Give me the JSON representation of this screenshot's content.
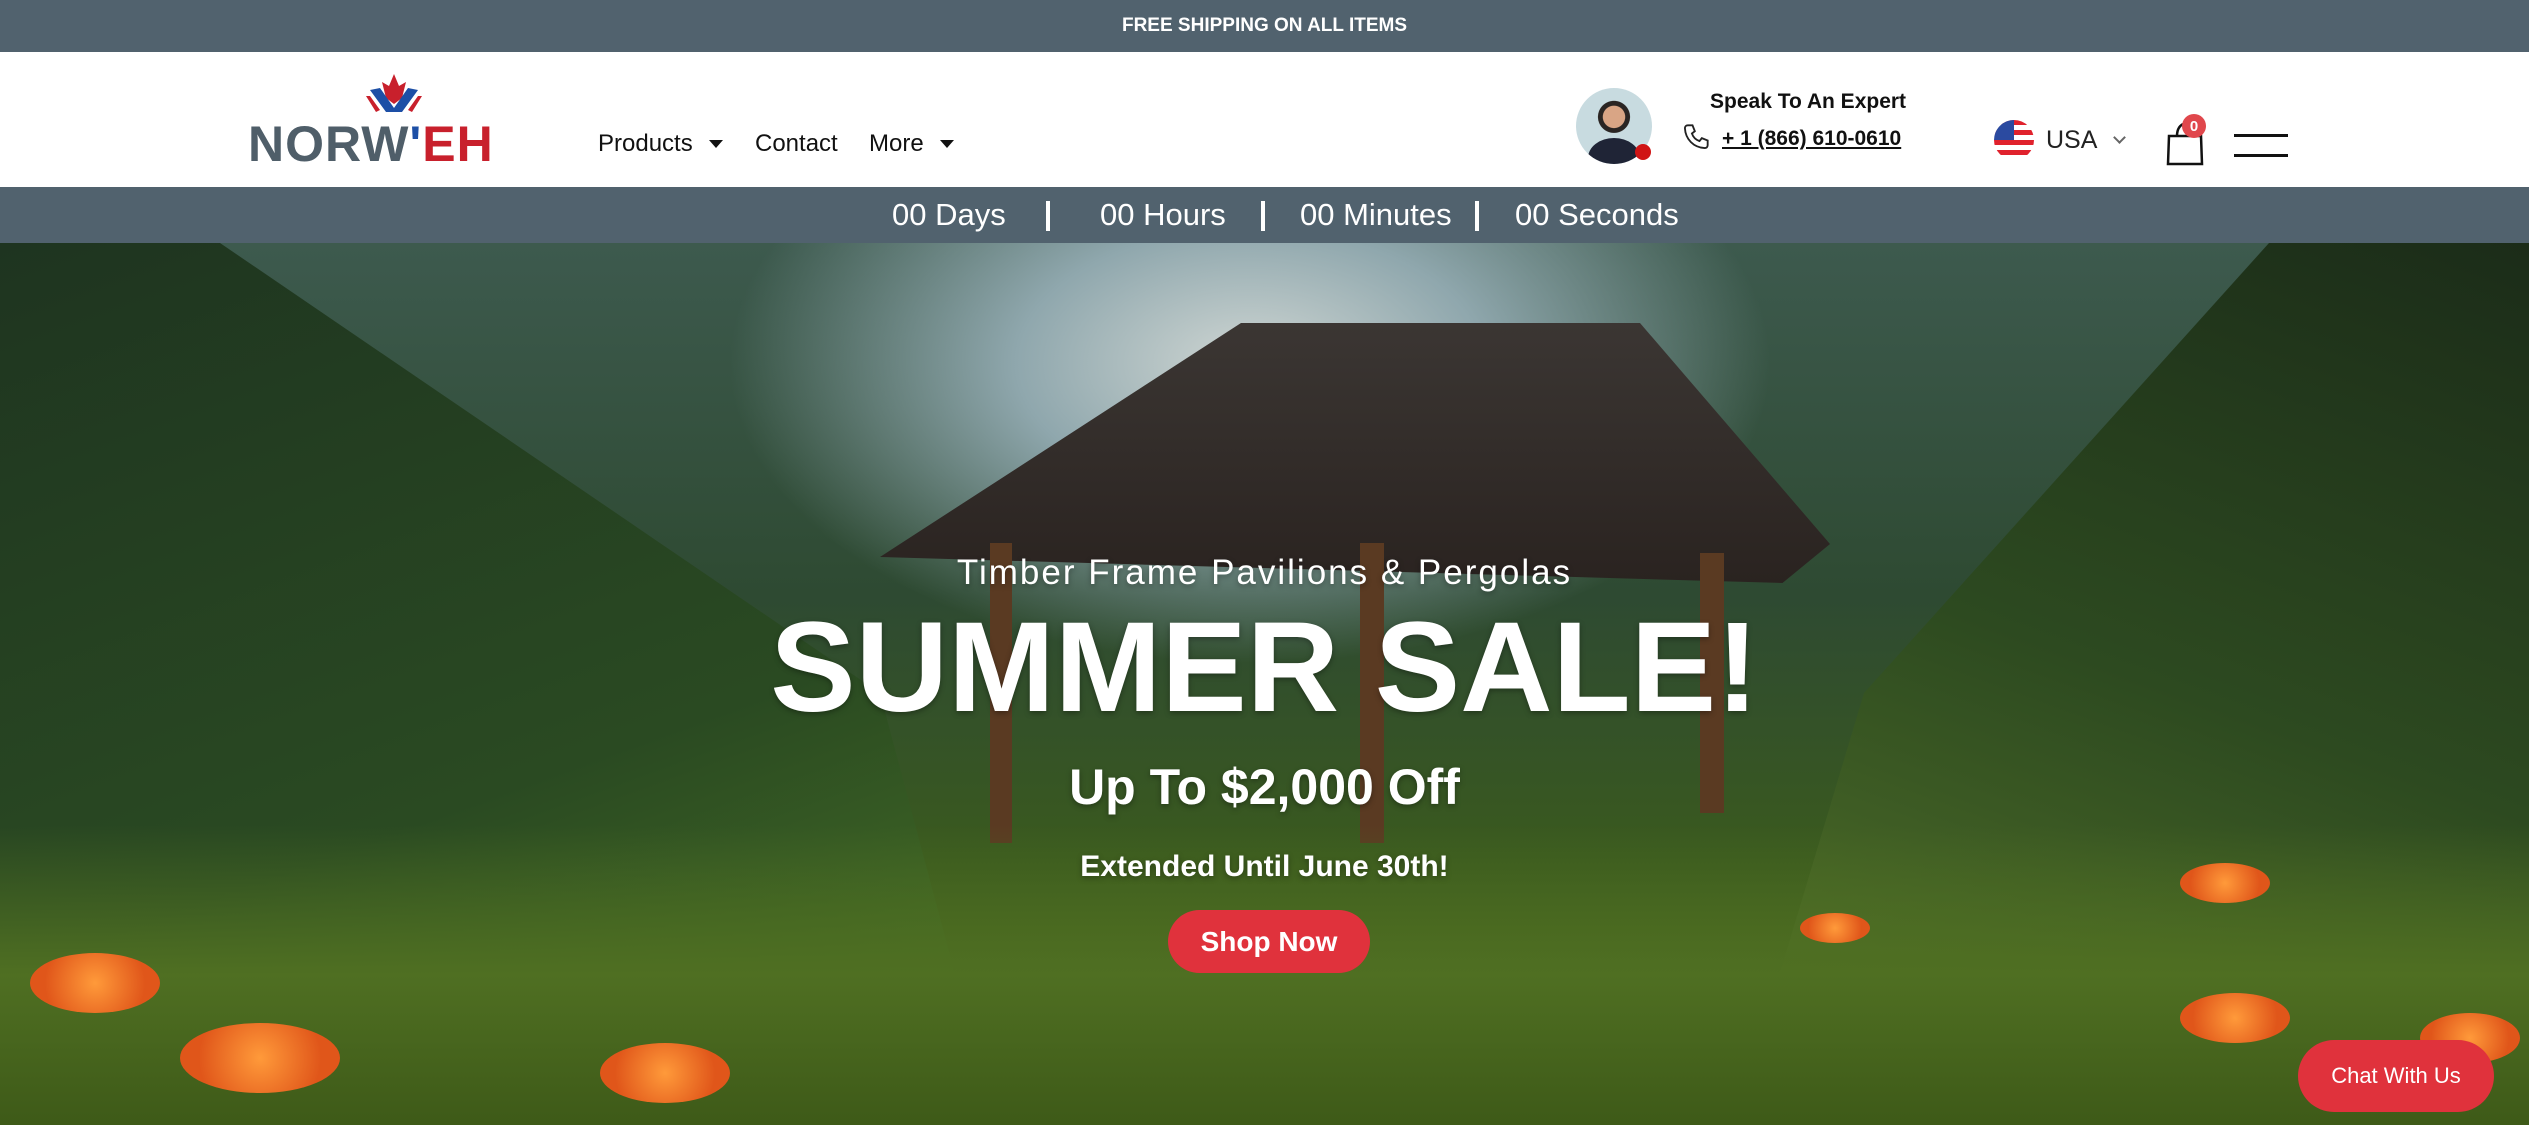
{
  "topbar": {
    "text": "FREE SHIPPING ON ALL ITEMS"
  },
  "header": {
    "logo": {
      "text_left": "NORW",
      "text_right": "EH",
      "apostrophe": "'",
      "colors": {
        "grey": "#4f5e69",
        "red": "#c8202c",
        "blue": "#1d4fa6"
      }
    },
    "nav": [
      {
        "label": "Products",
        "dropdown": true
      },
      {
        "label": "Contact",
        "dropdown": false
      },
      {
        "label": "More",
        "dropdown": true
      }
    ],
    "expert": {
      "title": "Speak To An Expert",
      "phone": "+ 1 (866) 610-0610"
    },
    "region": {
      "label": "USA",
      "icon": "us-flag-icon"
    },
    "cart": {
      "count": "0",
      "icon": "shopping-bag-icon"
    },
    "menu_icon": "hamburger-icon"
  },
  "countdown": {
    "days": "00 Days",
    "hours": "00 Hours",
    "minutes": "00 Minutes",
    "seconds": "00 Seconds"
  },
  "hero": {
    "subtitle": "Timber Frame Pavilions & Pergolas",
    "title": "SUMMER SALE!",
    "offer": "Up To $2,000 Off",
    "note": "Extended Until June 30th!",
    "cta": "Shop Now"
  },
  "chat": {
    "label": "Chat With Us"
  },
  "colors": {
    "accent": "#e0323c",
    "bar": "#51626e"
  }
}
